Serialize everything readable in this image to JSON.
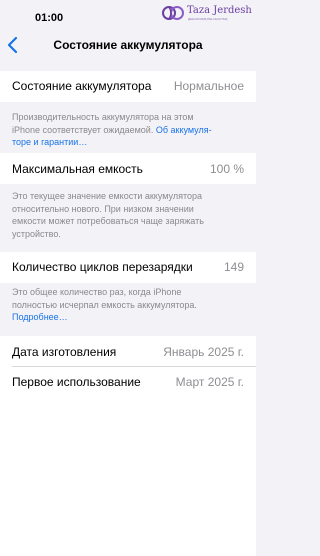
{
  "status_bar": {
    "time": "01:00"
  },
  "watermark": {
    "name": "Taza Jerdesh",
    "tagline": "ДЕНСАУЛЫҚ ПЕН ЖАСТЫҚ"
  },
  "nav": {
    "title": "Состояние аккумулятора"
  },
  "battery_health": {
    "label": "Состояние аккумулятора",
    "value": "Нормальное",
    "note_line1": "Производительность аккумулятора на этом",
    "note_line2_text": "iPhone соответствует ожидаемой. ",
    "note_line2_link": "Об аккумуля-",
    "note_line3_link": "торе и гарантии…"
  },
  "max_capacity": {
    "label": "Максимальная емкость",
    "value": "100 %",
    "note_line1": "Это текущее значение емкости аккумулятора",
    "note_line2": "относительно нового. При низком значении",
    "note_line3": "емкости может потребоваться чаще заряжать",
    "note_line4": "устройство."
  },
  "cycle_count": {
    "label": "Количество циклов перезарядки",
    "value": "149",
    "note_line1": "Это общее количество раз, когда iPhone",
    "note_line2": "полностью исчерпал емкость аккумулятора.",
    "note_link": "Подробнее…"
  },
  "dates": {
    "manufactured_label": "Дата изготовления",
    "manufactured_value": "Январь 2025 г.",
    "first_use_label": "Первое использование",
    "first_use_value": "Март 2025 г."
  }
}
